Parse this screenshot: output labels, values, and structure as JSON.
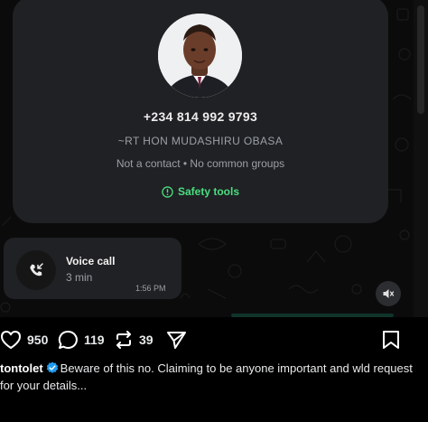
{
  "contact_card": {
    "phone": "+234 814 992 9793",
    "alias": "~RT HON MUDASHIRU OBASA",
    "status": "Not a contact • No common groups",
    "safety_tools": "Safety tools"
  },
  "call": {
    "title": "Voice call",
    "duration": "3 min",
    "time": "1:56 PM"
  },
  "post": {
    "likes": "950",
    "replies": "119",
    "reposts": "39",
    "username": "tontolet",
    "caption": "Beware of this no. Claiming to be anyone important and wld request for your details..."
  },
  "colors": {
    "card_bg": "#202124",
    "safety_green": "#4ade80",
    "verified_blue": "#1d9bf0"
  },
  "icons": [
    "avatar",
    "shield-icon",
    "incoming-call-icon",
    "mute-icon",
    "heart-icon",
    "comment-icon",
    "repost-icon",
    "share-icon",
    "bookmark-icon",
    "verified-icon"
  ]
}
